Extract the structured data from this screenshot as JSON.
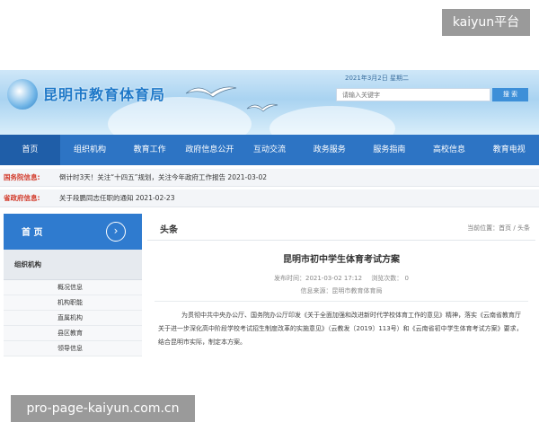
{
  "watermark_top": "kaiyun平台",
  "watermark_bottom": "pro-page-kaiyun.com.cn",
  "header": {
    "site_title": "昆明市教育体育局",
    "date": "2021年3月2日 星期二",
    "search_placeholder": "请输入关键字",
    "search_button": "搜 索"
  },
  "nav": {
    "items": [
      {
        "label": "首页"
      },
      {
        "label": "组织机构"
      },
      {
        "label": "教育工作"
      },
      {
        "label": "政府信息公开"
      },
      {
        "label": "互动交流"
      },
      {
        "label": "政务服务"
      },
      {
        "label": "服务指南"
      },
      {
        "label": "高校信息"
      },
      {
        "label": "教育电视"
      }
    ]
  },
  "notices": [
    {
      "label": "国务院信息:",
      "text": "倒计时3天！关注“十四五”规划，关注今年政府工作报告 2021-03-02"
    },
    {
      "label": "省政府信息:",
      "text": "关于段鹏同志任职的通知  2021-02-23"
    }
  ],
  "sidebar": {
    "home_label": "首 页",
    "arrow": "›",
    "group_label": "组织机构",
    "items": [
      {
        "label": "概况信息"
      },
      {
        "label": "机构职能"
      },
      {
        "label": "直属机构"
      },
      {
        "label": "县区教育"
      },
      {
        "label": "领导信息"
      }
    ]
  },
  "main": {
    "section_title": "头条",
    "breadcrumb": "当前位置：首页 / 头条",
    "article_title": "昆明市初中学生体育考试方案",
    "publish_time": "发布时间：2021-03-02 17:12",
    "views": "浏览次数： 0",
    "source": "信息来源：昆明市教育体育局",
    "body": "为贯彻中共中央办公厅、国务院办公厅印发《关于全面加强和改进新时代学校体育工作的意见》精神，落实《云南省教育厅关于进一步深化高中阶段学校考试招生制度改革的实施意见》（云教发〔2019〕113号）和《云南省初中学生体育考试方案》要求，结合昆明市实际，制定本方案。"
  },
  "colors": {
    "nav_bg": "#2d74c4",
    "accent": "#2f7bcf",
    "notice_label": "#d23a2a"
  }
}
